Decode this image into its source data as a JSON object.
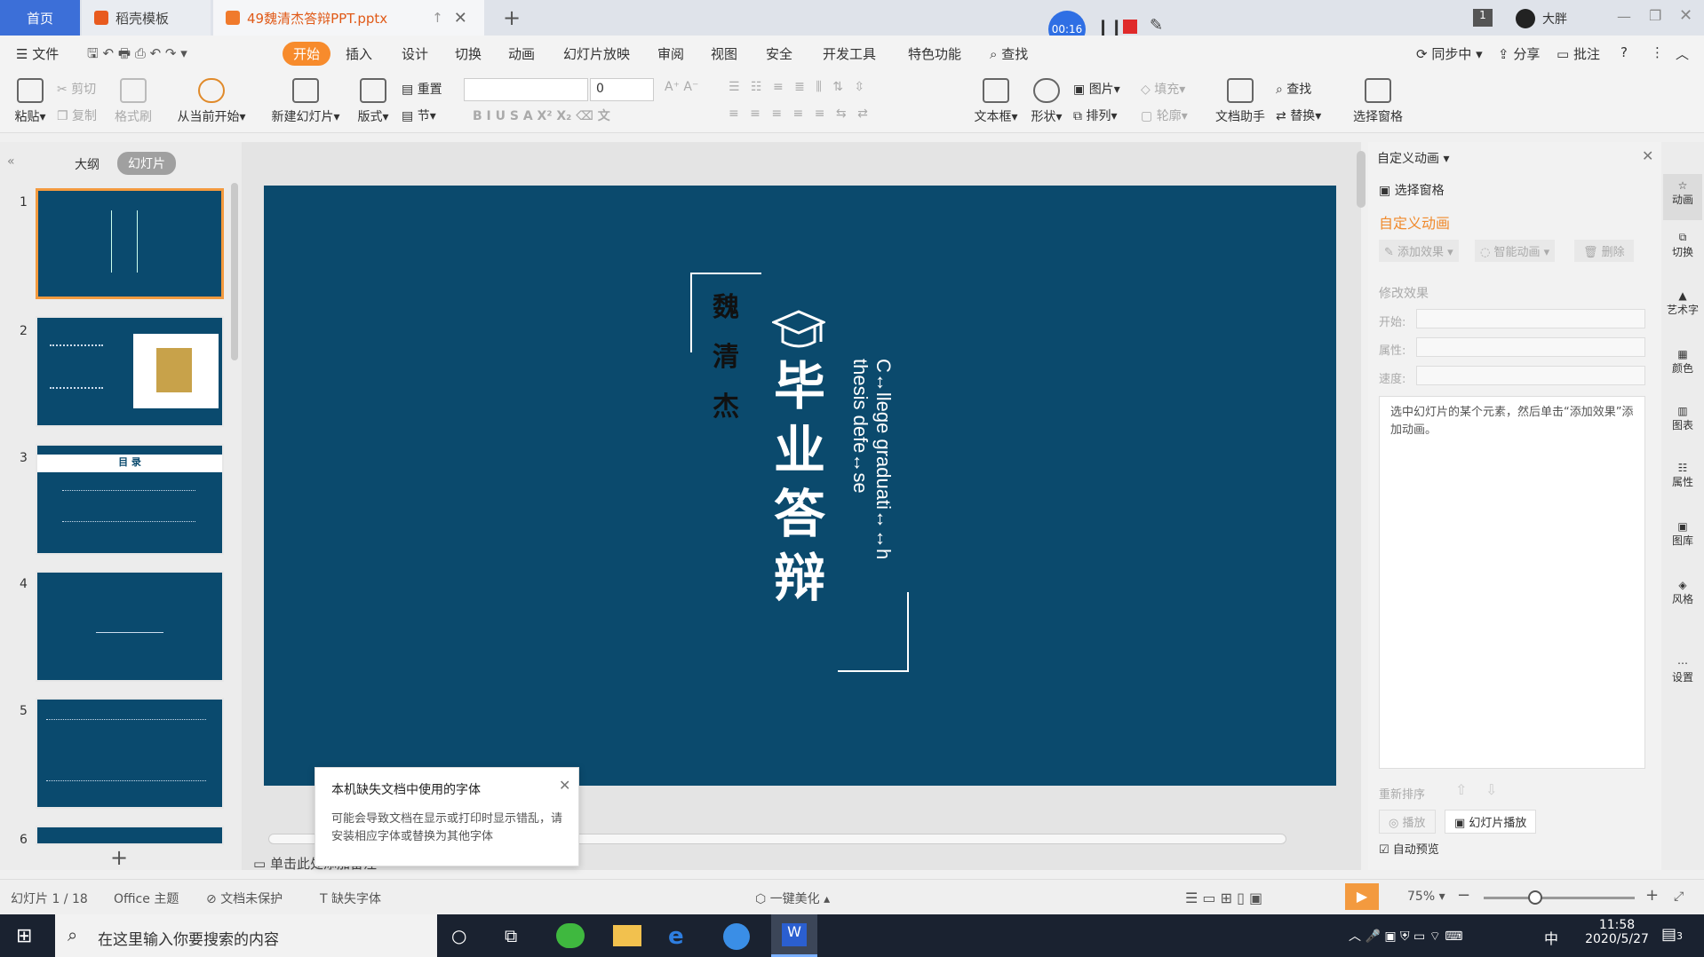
{
  "titlebar": {
    "tabs": [
      {
        "label": "首页"
      },
      {
        "label": "稻壳模板"
      },
      {
        "label": "49魏清杰答辩PPT.pptx"
      }
    ],
    "new_tab": "+",
    "recording_time": "00:16",
    "window_badge": "1",
    "user_name": "大胖"
  },
  "menubar": {
    "file": "文件",
    "items": [
      "开始",
      "插入",
      "设计",
      "切换",
      "动画",
      "幻灯片放映",
      "审阅",
      "视图",
      "安全",
      "开发工具",
      "特色功能"
    ],
    "search": "查找",
    "sync": "同步中",
    "share": "分享",
    "comment": "批注"
  },
  "ribbon": {
    "paste": "粘贴",
    "cut": "剪切",
    "copy": "复制",
    "format_painter": "格式刷",
    "play_from_current": "从当前开始",
    "new_slide": "新建幻灯片",
    "layout": "版式",
    "reset": "重置",
    "section": "节",
    "font_name": "",
    "font_size": "0",
    "textbox": "文本框",
    "shape": "形状",
    "picture": "图片",
    "arrange": "排列",
    "fill": "填充",
    "outline": "轮廓",
    "doc_assistant": "文档助手",
    "find": "查找",
    "replace": "替换",
    "selection_pane": "选择窗格"
  },
  "leftpanel": {
    "tab_outline": "大纲",
    "tab_slides": "幻灯片",
    "thumbnails": [
      {
        "num": "1"
      },
      {
        "num": "2"
      },
      {
        "num": "3",
        "title": "目 录"
      },
      {
        "num": "4"
      },
      {
        "num": "5"
      },
      {
        "num": "6"
      }
    ],
    "add": "+"
  },
  "slide": {
    "name": "魏清杰",
    "name_chars": [
      "魏",
      "清",
      "杰"
    ],
    "title_chars": [
      "毕",
      "业",
      "答",
      "辩"
    ],
    "english_line1": "C↔llege graduati↔↔h",
    "english_line2": "thesis defe↔se"
  },
  "editor": {
    "notes_placeholder": "单击此处添加备注"
  },
  "font_warning": {
    "title": "本机缺失文档中使用的字体",
    "body": "可能会导致文档在显示或打印时显示错乱，请安装相应字体或替换为其他字体"
  },
  "rpanel": {
    "header": "自定义动画",
    "selection_pane": "选择窗格",
    "section_title": "自定义动画",
    "add_effect": "添加效果",
    "smart_anim": "智能动画",
    "delete": "删除",
    "modify": "修改效果",
    "start_label": "开始:",
    "property_label": "属性:",
    "speed_label": "速度:",
    "hint": "选中幻灯片的某个元素，然后单击“添加效果”添加动画。",
    "reorder": "重新排序",
    "play": "播放",
    "slideshow": "幻灯片播放",
    "autopreview": "自动预览"
  },
  "rside": {
    "items": [
      "动画",
      "切换",
      "艺术字",
      "颜色",
      "图表",
      "属性",
      "图库",
      "风格",
      "设置"
    ]
  },
  "status": {
    "slide_info": "幻灯片 1 / 18",
    "theme": "Office 主题",
    "protect": "文档未保护",
    "missing_font": "缺失字体",
    "beautify": "一键美化",
    "zoom": "75%"
  },
  "taskbar": {
    "search_placeholder": "在这里输入你要搜索的内容",
    "ime": "中",
    "time": "11:58",
    "date": "2020/5/27",
    "notify": "3"
  }
}
